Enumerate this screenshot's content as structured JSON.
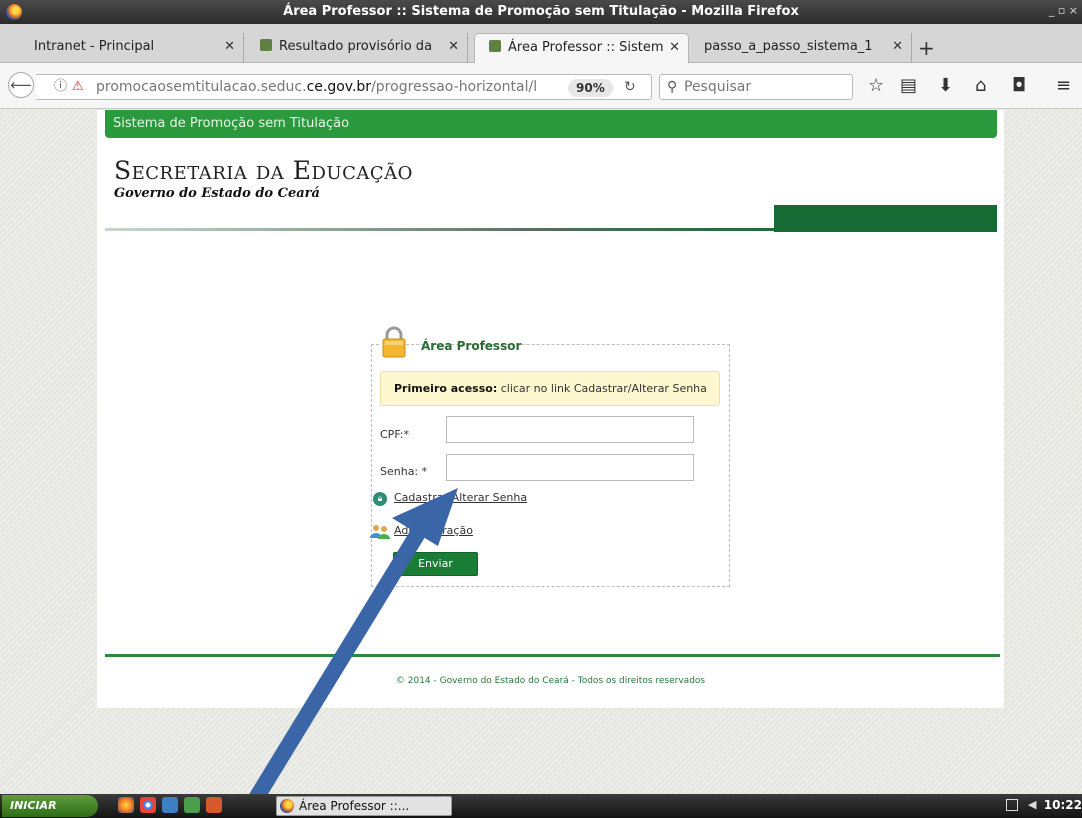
{
  "window": {
    "title": "Área Professor :: Sistema de Promoção sem Titulação - Mozilla Firefox",
    "controls": "_ ▫ ×"
  },
  "tabs": [
    {
      "label": "Intranet - Principal",
      "active": false
    },
    {
      "label": "Resultado provisório da",
      "active": false
    },
    {
      "label": "Área Professor :: Sistem",
      "active": true
    },
    {
      "label": "passo_a_passo_sistema_1",
      "active": false
    }
  ],
  "navbar": {
    "url_prefix": "promocaosemtitulacao.seduc.",
    "url_domain": "ce.gov.br",
    "url_suffix": "/progressao-horizontal/lo",
    "zoom": "90%",
    "search_placeholder": "Pesquisar"
  },
  "page": {
    "system_name": "Sistema de Promoção sem Titulação",
    "brand_title": "Secretaria da Educação",
    "brand_subtitle": "Governo do Estado do Ceará",
    "login": {
      "legend": "Área Professor",
      "notice_bold": "Primeiro acesso:",
      "notice_text": " clicar no link Cadastrar/Alterar Senha",
      "cpf_label": "CPF:*",
      "senha_label": "Senha: *",
      "cpf_value": "",
      "senha_value": "",
      "cadastrar_link": "Cadastrar/Alterar Senha",
      "admin_link": "Administração",
      "submit": "Enviar"
    },
    "footer": "© 2014 - Governo do Estado do Ceará - Todos os direitos reservados"
  },
  "taskbar": {
    "start": "INICIAR",
    "task_label": "Área Professor ::...",
    "clock": "10:22"
  },
  "colors": {
    "primary_green": "#2b9a3f",
    "dark_green": "#156b33",
    "arrow_blue": "#3a66a8"
  }
}
